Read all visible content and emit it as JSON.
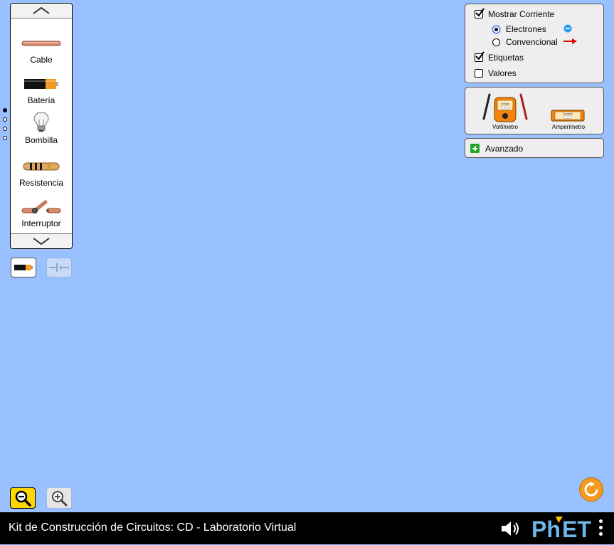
{
  "carousel": {
    "items": [
      {
        "label": "Cable",
        "icon": "wire-icon"
      },
      {
        "label": "Batería",
        "icon": "battery-icon"
      },
      {
        "label": "Bombilla",
        "icon": "light-bulb-icon"
      },
      {
        "label": "Resistencia",
        "icon": "resistor-icon"
      },
      {
        "label": "Interruptor",
        "icon": "switch-icon"
      }
    ],
    "page_count": 4,
    "current_page": 1
  },
  "view_toggle": {
    "lifelike_icon": "battery-icon",
    "schematic_icon": "schematic-battery-icon",
    "selected": "lifelike"
  },
  "display_options": {
    "show_current_label": "Mostrar Corriente",
    "show_current_checked": true,
    "electrons_label": "Electrones",
    "conventional_label": "Convencional",
    "current_type_selected": "Electrones",
    "labels_label": "Etiquetas",
    "labels_checked": true,
    "values_label": "Valores",
    "values_checked": false
  },
  "sensors": {
    "voltmeter_label": "Voltímetro",
    "ammeter_label": "Amperímetro",
    "voltmeter_screen": "Voltaje",
    "ammeter_screen": "Corriente",
    "meter_reading": "?"
  },
  "advanced": {
    "label": "Avanzado"
  },
  "footer": {
    "title": "Kit de Construcción de Circuitos: CD - Laboratorio Virtual",
    "brand": "PhET"
  },
  "colors": {
    "background": "#99c0ff",
    "navbar": "#000000",
    "reset_button": "#f49b1f",
    "zoom_out_active": "#ffd700",
    "electron_blue": "#2b9cf2",
    "conventional_arrow": "#e00000",
    "advanced_plus": "#22a32a"
  }
}
